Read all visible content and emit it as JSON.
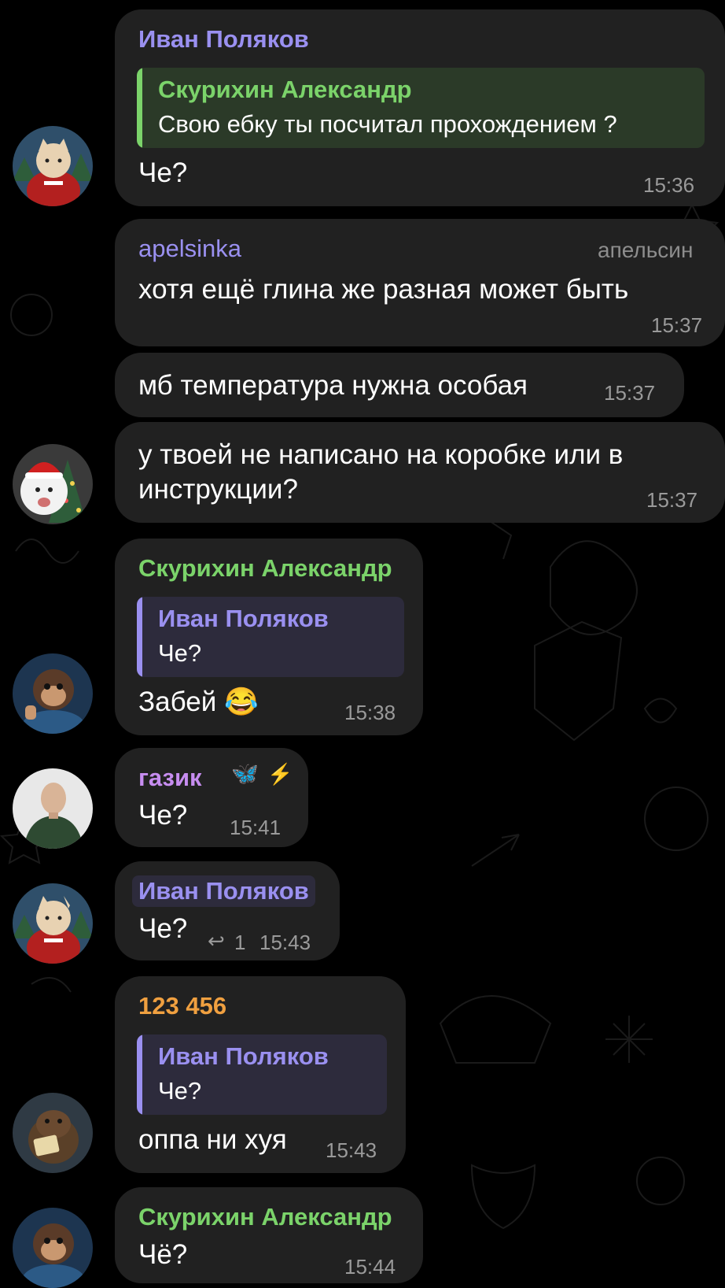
{
  "colors": {
    "background": "#000000",
    "bubble": "#212121",
    "purple_name": "#9a90f0",
    "green_name": "#7bd36a",
    "orange_name": "#f0a040",
    "pink_name": "#c78df0",
    "time": "#9a9a9a"
  },
  "messages": [
    {
      "sender": "Иван Поляков",
      "quote": {
        "name": "Скурихин Александр",
        "text": "Свою ебку ты посчитал прохождением ?"
      },
      "text": "Че?",
      "time": "15:36",
      "avatar": "cat-santa-avatar"
    },
    {
      "sender": "apelsinka",
      "role": "апельсин",
      "text": "хотя ещё глина же разная может быть",
      "time": "15:37"
    },
    {
      "text": "мб температура нужна особая",
      "time": "15:37"
    },
    {
      "text_line1": "у твоей не написано на коробке или в",
      "text_line2": "инструкции?",
      "time": "15:37",
      "avatar": "white-cat-christmas-avatar"
    },
    {
      "sender": "Скурихин Александр",
      "quote": {
        "name": "Иван Поляков",
        "text": "Че?"
      },
      "text": "Забей 😂",
      "time": "15:38",
      "avatar": "chimp-astronaut-avatar"
    },
    {
      "sender": "газик",
      "emoji_status": "🦋",
      "badge": "⚡",
      "text": "Че?",
      "time": "15:41",
      "avatar": "bald-man-avatar"
    },
    {
      "sender": "Иван Поляков",
      "text": "Че?",
      "reply_count": "1",
      "reply_icon": "↩",
      "time": "15:43",
      "avatar": "cat-santa-avatar"
    },
    {
      "sender": "123 456",
      "quote": {
        "name": "Иван Поляков",
        "text": "Че?"
      },
      "text": "оппа ни хуя",
      "time": "15:43",
      "avatar": "otter-avatar"
    },
    {
      "sender": "Скурихин Александр",
      "text": "Чё?",
      "time": "15:44",
      "avatar": "chimp-astronaut-avatar"
    }
  ]
}
